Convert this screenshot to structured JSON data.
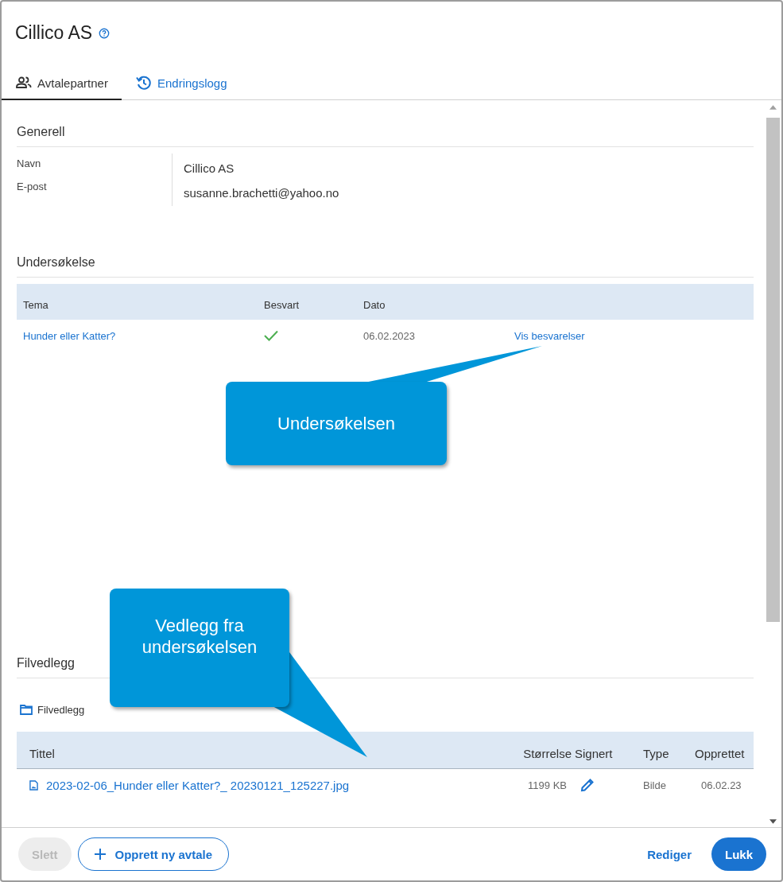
{
  "window": {
    "title": "Cillico AS"
  },
  "tabs": [
    {
      "label": "Avtalepartner",
      "selected": true,
      "kind": "people"
    },
    {
      "label": "Endringslogg",
      "selected": false,
      "kind": "history"
    }
  ],
  "general": {
    "heading": "Generell",
    "fields": [
      {
        "label": "Navn",
        "value": "Cillico AS"
      },
      {
        "label": "E-post",
        "value": "susanne.brachetti@yahoo.no"
      }
    ]
  },
  "survey": {
    "heading": "Undersøkelse",
    "columns": [
      "Tema",
      "Besvart",
      "Dato"
    ],
    "rows": [
      {
        "topic": "Hunder eller Katter?",
        "answered": true,
        "date": "06.02.2023",
        "link": "Vis besvarelser"
      }
    ]
  },
  "attachments": {
    "heading": "Filvedlegg",
    "folder": "Filvedlegg",
    "columns": [
      "Tittel",
      "Størrelse",
      "Signert",
      "Type",
      "Opprettet"
    ],
    "rows": [
      {
        "title": "2023-02-06_Hunder eller Katter?_ 20230121_125227.jpg",
        "size": "1199 KB",
        "type": "Bilde",
        "created": "06.02.23"
      }
    ]
  },
  "callouts": [
    {
      "text": "Undersøkelsen",
      "kind": "up"
    },
    {
      "text": "Vedlegg fra undersøkelsen",
      "kind": "down"
    }
  ],
  "buttons": [
    {
      "label": "Slett",
      "kind": "plain",
      "disabled": true
    },
    {
      "label": "Opprett ny avtale",
      "kind": "outline",
      "disabled": false
    },
    {
      "label": "Rediger",
      "kind": "text",
      "disabled": false
    },
    {
      "label": "Lukk",
      "kind": "primary",
      "disabled": false
    }
  ]
}
